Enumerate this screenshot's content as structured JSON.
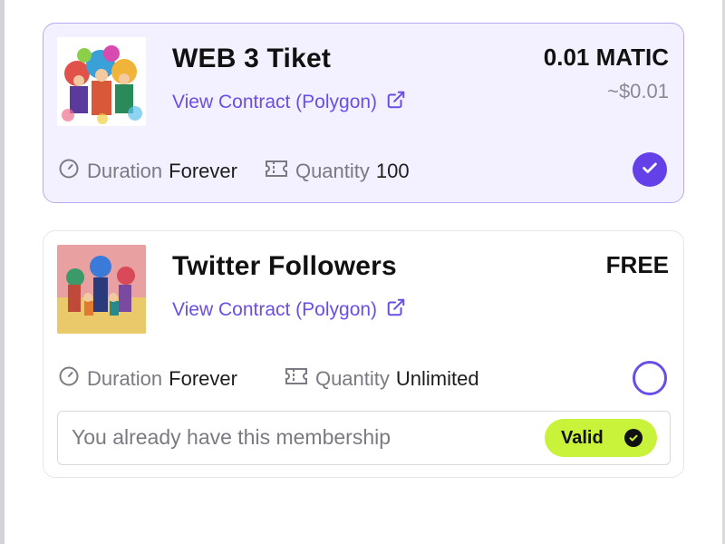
{
  "memberships": [
    {
      "title": "WEB 3 Tiket",
      "contract_link": "View Contract (Polygon)",
      "price": "0.01 MATIC",
      "price_usd": "~$0.01",
      "duration_label": "Duration",
      "duration_value": "Forever",
      "quantity_label": "Quantity",
      "quantity_value": "100",
      "selected": true
    },
    {
      "title": "Twitter Followers",
      "contract_link": "View Contract (Polygon)",
      "price": "FREE",
      "duration_label": "Duration",
      "duration_value": "Forever",
      "quantity_label": "Quantity",
      "quantity_value": "Unlimited",
      "selected": false,
      "notice": "You already have this membership",
      "badge": "Valid"
    }
  ],
  "colors": {
    "accent": "#6340e8",
    "link": "#6b4ee6",
    "selected_bg": "#f3f1ff",
    "badge_bg": "#c9f23a"
  },
  "icons": [
    "clock-icon",
    "ticket-icon",
    "external-link-icon",
    "check-icon"
  ]
}
